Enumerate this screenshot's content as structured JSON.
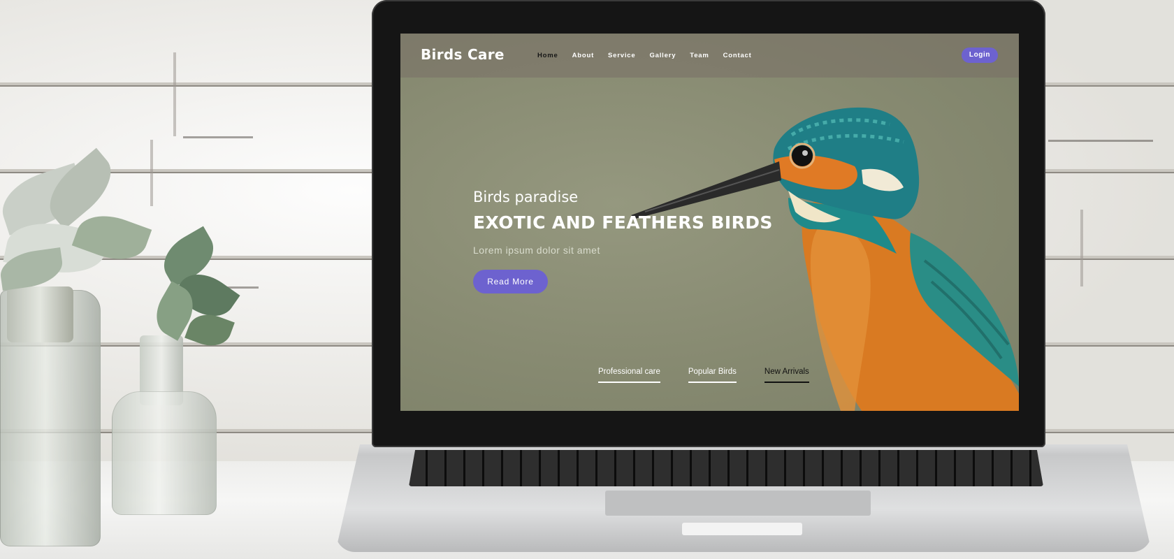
{
  "website": {
    "brand": "Birds Care",
    "nav": [
      "Home",
      "About",
      "Service",
      "Gallery",
      "Team",
      "Contact"
    ],
    "active_nav_index": 0,
    "login_label": "Login",
    "hero": {
      "kicker": "Birds paradise",
      "title": "EXOTIC AND FEATHERS BIRDS",
      "subtitle": "Lorem ipsum dolor sit amet",
      "cta_label": "Read More"
    },
    "tabs": [
      "Professional care",
      "Popular Birds",
      "New Arrivals"
    ],
    "active_tab_index": 2
  },
  "colors": {
    "accent": "#6d62cf",
    "hero_background": "#878a71",
    "nav_overlay": "#786e66"
  },
  "icons": {
    "hero_image": "kingfisher-bird"
  }
}
